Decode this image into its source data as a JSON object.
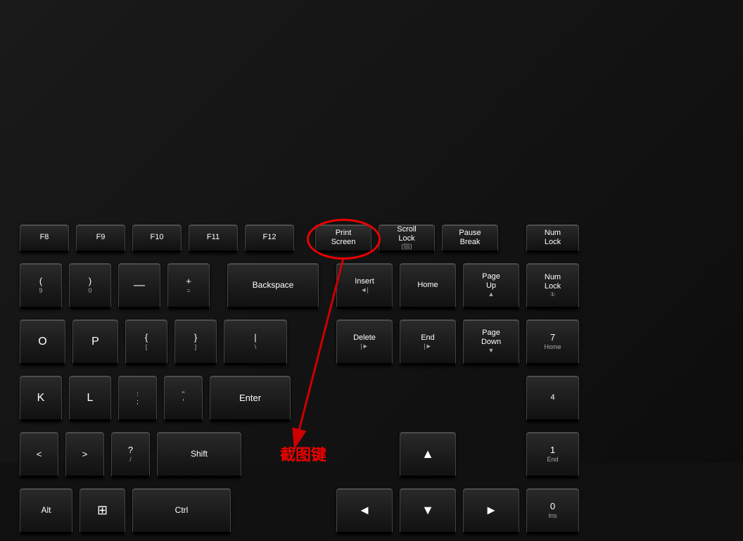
{
  "keys": {
    "f8": "F8",
    "f9": "F9",
    "f10": "F10",
    "f11": "F11",
    "f12": "F12",
    "prtsc_line1": "Print",
    "prtsc_line2": "Screen",
    "scrolllock_line1": "Scroll",
    "scrolllock_line2": "Lock",
    "pause_line1": "Pause",
    "pause_line2": "Break",
    "numlock": "Num\nLock",
    "oparen_top": "(",
    "oparen_bot": "9",
    "cparen_top": ")",
    "cparen_bot": "0",
    "minus": "—",
    "plus": "+",
    "equals": "=",
    "backspace": "Backspace",
    "insert_line1": "Insert",
    "insert_line2": "◄|",
    "home": "Home",
    "pageup_line1": "Page",
    "pageup_line2": "Up",
    "pageup_arrow": "▲",
    "numlock2_line1": "Num",
    "numlock2_line2": "Lock",
    "numlock2_line3": "①",
    "o": "O",
    "p": "P",
    "lbrace_top": "{",
    "lbrace_bot": "[",
    "rbrace_top": "}",
    "rbrace_bot": "]",
    "pipe_top": "|",
    "pipe_bot": "\\",
    "delete_line1": "Delete",
    "delete_line2": "|►",
    "end_line1": "End",
    "end_line2": "|►",
    "pagedown_line1": "Page",
    "pagedown_line2": "Down",
    "pagedown_arrow": "▼",
    "num7_top": "7",
    "num7_bot": "Home",
    "k": "K",
    "l": "L",
    "colon_top": ":",
    "semicolon_bot": ";",
    "quote_top": "\"",
    "quote_bot": "'",
    "enter": "Enter",
    "num4": "4",
    "less": "<",
    "greater": ">",
    "question_top": "?",
    "slash_bot": "/",
    "shift": "Shift",
    "up_arrow": "▲",
    "num1_top": "1",
    "num1_bot": "End",
    "alt": "Alt",
    "winkey": "⊞",
    "ctrl": "Ctrl",
    "left_arrow": "◄",
    "down_arrow": "▼",
    "right_arrow": "►",
    "num0_top": "0",
    "num0_bot": "Ins",
    "label_jietu": "截图键"
  }
}
